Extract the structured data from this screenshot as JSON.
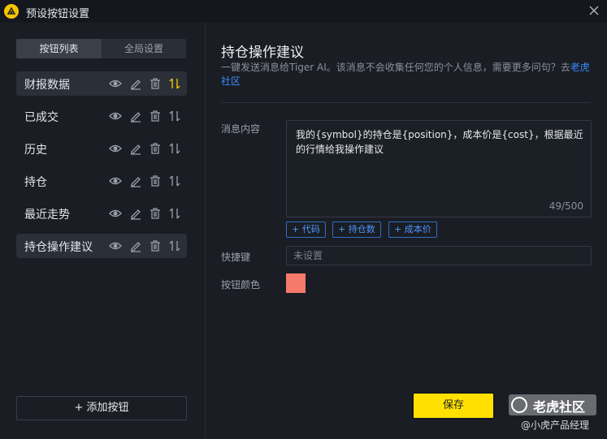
{
  "window": {
    "title": "预设按钮设置"
  },
  "sidebar": {
    "tabs": [
      {
        "label": "按钮列表"
      },
      {
        "label": "全局设置"
      }
    ],
    "items": [
      {
        "label": "财报数据"
      },
      {
        "label": "已成交"
      },
      {
        "label": "历史"
      },
      {
        "label": "持仓"
      },
      {
        "label": "最近走势"
      },
      {
        "label": "持仓操作建议"
      }
    ],
    "add_label": "添加按钮",
    "add_icon": "+"
  },
  "main": {
    "title": "持仓操作建议",
    "desc": "一键发送消息给Tiger AI。该消息不会收集任何您的个人信息，需要更多问句？去",
    "desc_link": "老虎社区",
    "message_label": "消息内容",
    "message_text": "我的{symbol}的持仓是{position}，成本价是{cost}，根据最近的行情给我操作建议",
    "char_count": "49/500",
    "chips": [
      {
        "label": "+ 代码"
      },
      {
        "label": "+ 持仓数"
      },
      {
        "label": "+ 成本价"
      }
    ],
    "shortcut_label": "快捷键",
    "shortcut_placeholder": "未设置",
    "color_label": "按钮颜色",
    "button_color": "#f67a6c",
    "save_label": "保存"
  },
  "watermark": {
    "title": "老虎社区",
    "subtitle": "@小虎产品经理"
  },
  "colors": {
    "accent": "#ffe000",
    "link": "#3a8cff",
    "sort_active": "#f5c400"
  }
}
